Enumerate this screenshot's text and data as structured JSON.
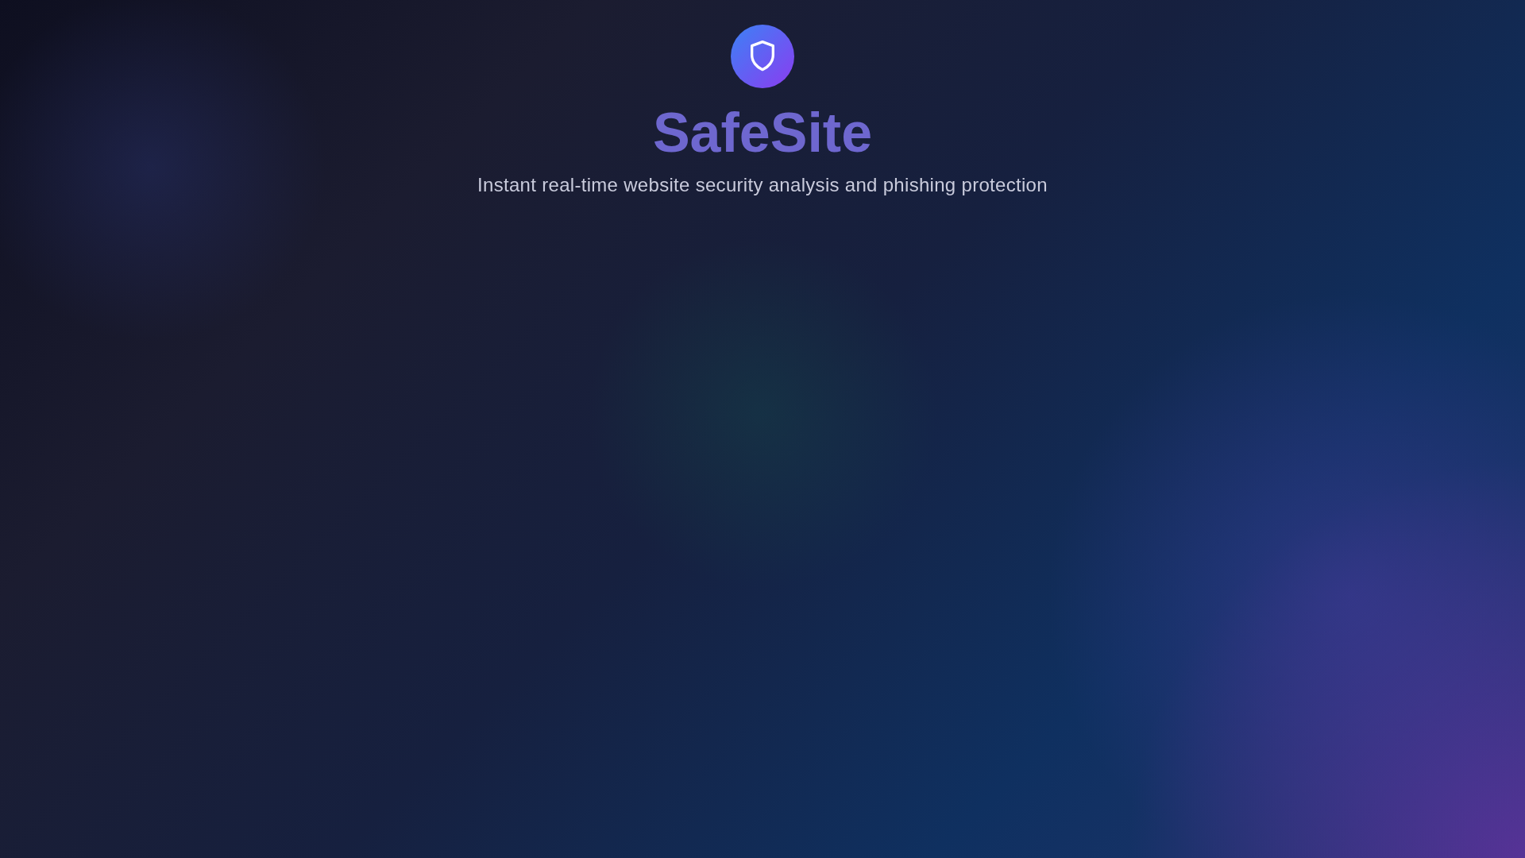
{
  "header": {
    "title": "SafeSite",
    "subtitle": "Instant real-time website security analysis and phishing protection"
  }
}
